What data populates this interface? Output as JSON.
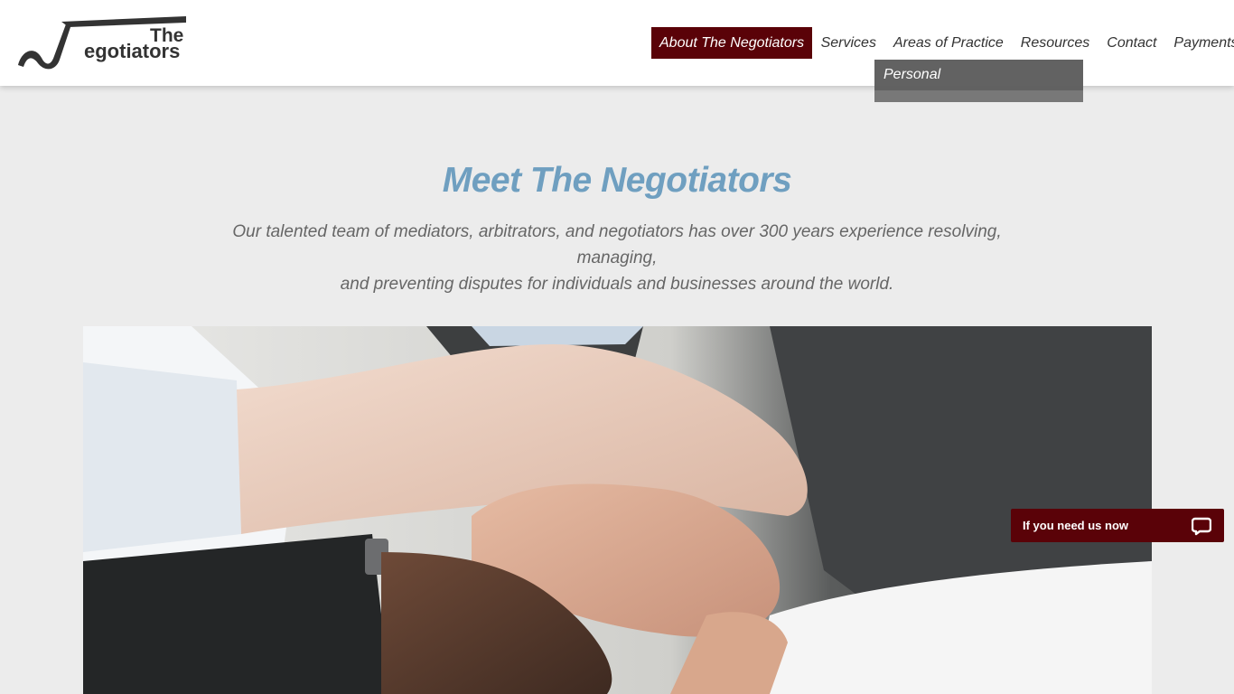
{
  "brand": {
    "logo_the": "The",
    "logo_rest": "egotiators"
  },
  "nav": {
    "items": [
      {
        "label": "About The Negotiators"
      },
      {
        "label": "Services"
      },
      {
        "label": "Areas of Practice"
      },
      {
        "label": "Resources"
      },
      {
        "label": "Contact"
      },
      {
        "label": "Payments"
      }
    ],
    "active": "About The Negotiators"
  },
  "dropdown": {
    "items": [
      {
        "label": "Personal"
      }
    ]
  },
  "main": {
    "title": "Meet The Negotiators",
    "subtitle_line1": "Our talented team of mediators, arbitrators, and negotiators has over 300 years experience resolving, managing,",
    "subtitle_line2": "and preventing disputes for individuals and businesses around the world."
  },
  "chat": {
    "label": "If you need us now",
    "icon": "chat-bubble-icon"
  },
  "colors": {
    "accent": "#5a0208",
    "title_blue": "#6f9fc0",
    "background": "#ececec"
  }
}
